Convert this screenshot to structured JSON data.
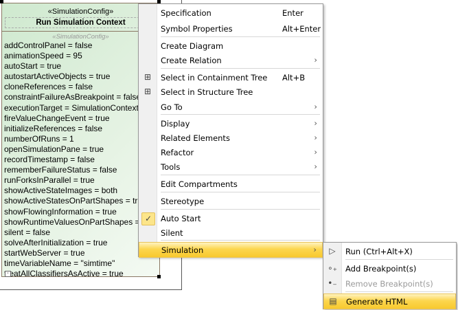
{
  "diagram": {
    "stereotype": "«SimulationConfig»",
    "name": "Run Simulation Context",
    "compartment_stereotype": "«SimulationConfig»",
    "properties": [
      "addControlPanel = false",
      "animationSpeed = 95",
      "autoStart = true",
      "autostartActiveObjects = true",
      "cloneReferences = false",
      "constraintFailureAsBreakpoint = false",
      "executionTarget = SimulationContext",
      "fireValueChangeEvent = true",
      "initializeReferences = false",
      "numberOfRuns = 1",
      "openSimulationPane = true",
      "recordTimestamp = false",
      "rememberFailureStatus = false",
      "runForksInParallel = true",
      "showActiveStateImages = both",
      "showActiveStatesOnPartShapes = true",
      "showFlowingInformation = true",
      "showRuntimeValuesOnPartShapes = true",
      "silent = false",
      "solveAfterInitialization = true",
      "startWebServer = true",
      "timeVariableName = \"simtime\"",
      "treatAllClassifiersAsActive = true"
    ]
  },
  "context_menu": {
    "items": [
      {
        "label": "Specification",
        "shortcut": "Enter"
      },
      {
        "label": "Symbol Properties",
        "shortcut": "Alt+Enter"
      },
      {
        "label": "Create Diagram"
      },
      {
        "label": "Create Relation",
        "submenu": true
      },
      {
        "label": "Select in Containment Tree",
        "shortcut": "Alt+B",
        "icon": "containment-tree-icon"
      },
      {
        "label": "Select in Structure Tree",
        "icon": "structure-tree-icon"
      },
      {
        "label": "Go To",
        "submenu": true
      },
      {
        "label": "Display",
        "submenu": true
      },
      {
        "label": "Related Elements",
        "submenu": true
      },
      {
        "label": "Refactor",
        "submenu": true
      },
      {
        "label": "Tools",
        "submenu": true
      },
      {
        "label": "Edit Compartments"
      },
      {
        "label": "Stereotype"
      },
      {
        "label": "Auto Start",
        "checked": true
      },
      {
        "label": "Silent"
      },
      {
        "label": "Simulation",
        "submenu": true,
        "highlighted": true
      }
    ]
  },
  "simulation_submenu": {
    "items": [
      {
        "label": "Run (Ctrl+Alt+X)",
        "icon": "run-icon"
      },
      {
        "label": "Add Breakpoint(s)",
        "icon": "add-breakpoint-icon"
      },
      {
        "label": "Remove Breakpoint(s)",
        "icon": "remove-breakpoint-icon",
        "disabled": true
      },
      {
        "label": "Generate HTML",
        "icon": "html-icon",
        "highlighted": true
      }
    ]
  },
  "symbols": {
    "arrow": "›",
    "check": "✓"
  }
}
